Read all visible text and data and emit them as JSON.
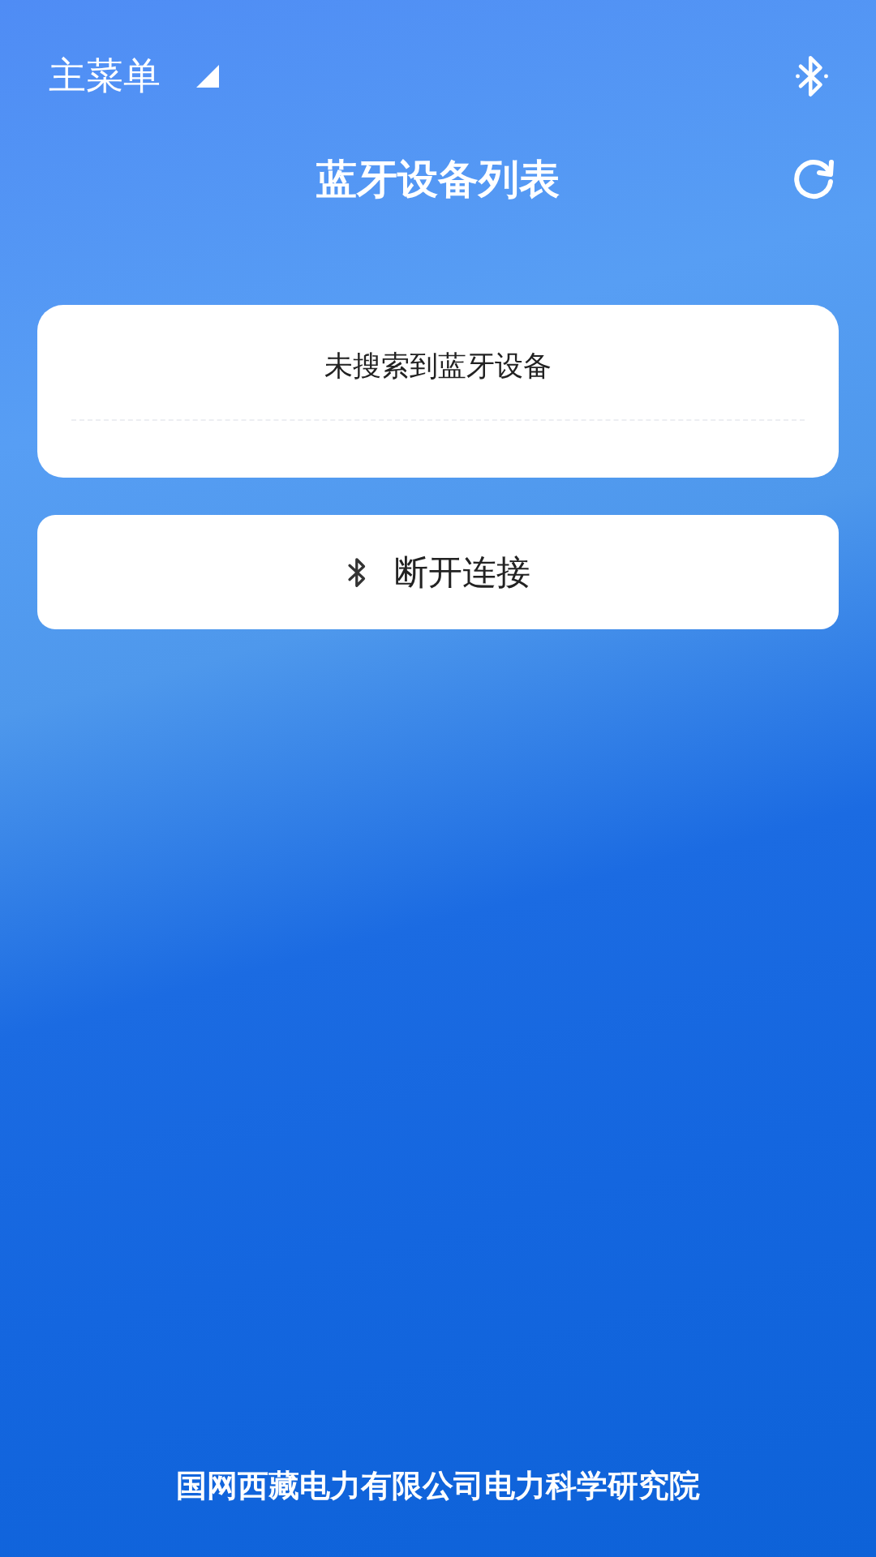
{
  "top_bar": {
    "menu_label": "主菜单"
  },
  "header": {
    "title": "蓝牙设备列表"
  },
  "device_list": {
    "empty_message": "未搜索到蓝牙设备"
  },
  "disconnect_button": {
    "label": "断开连接"
  },
  "footer": {
    "text": "国网西藏电力有限公司电力科学研究院"
  }
}
